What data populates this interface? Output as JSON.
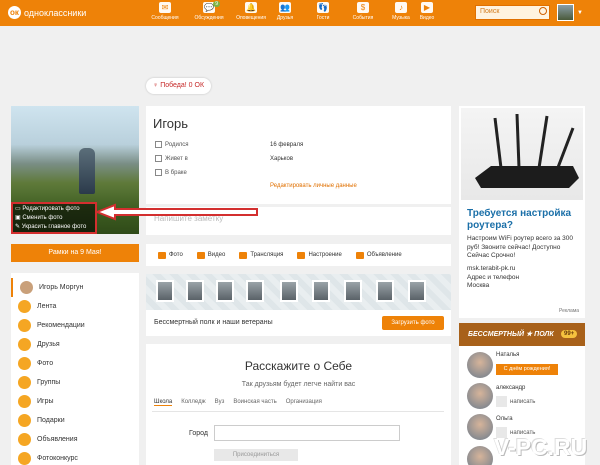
{
  "header": {
    "logo_text": "одноклассники",
    "logo_letter": "ок",
    "nav": [
      {
        "label": "Сообщения",
        "icon": "✉"
      },
      {
        "label": "Обсуждения",
        "icon": "💬",
        "badge": "9"
      },
      {
        "label": "Оповещения",
        "icon": "🔔"
      },
      {
        "label": "Друзья",
        "icon": "👥"
      },
      {
        "label": "Гости",
        "icon": "👣"
      },
      {
        "label": "События",
        "icon": "$"
      },
      {
        "label": "Музыка",
        "icon": "♪"
      },
      {
        "label": "Видео",
        "icon": "▶"
      }
    ],
    "search_placeholder": "Поиск",
    "caret": "▼"
  },
  "victory_label": "Победа! 0 ОК",
  "victory_icon": "♀",
  "photo_menu": [
    "Редактировать фото",
    "Сменить фото",
    "Украсить главное фото"
  ],
  "frames_button": "Рамки на 9 Мая!",
  "profile": {
    "name": "Игорь",
    "rows": [
      {
        "label": "Родился",
        "value": "16 февраля"
      },
      {
        "label": "Живет в",
        "value": "Харьков"
      },
      {
        "label": "В браке",
        "value": ""
      }
    ],
    "edit_link": "Редактировать личные данные"
  },
  "note_placeholder": "Напишите заметку",
  "post_actions": [
    "Фото",
    "Видео",
    "Трансляция",
    "Настроение",
    "Объявление"
  ],
  "left_nav": [
    "Игорь Моргун",
    "Лента",
    "Рекомендации",
    "Друзья",
    "Фото",
    "Группы",
    "Игры",
    "Подарки",
    "Объявления",
    "Фотоконкурс"
  ],
  "banner": {
    "text": "Бессмертный полк и наши ветераны",
    "button": "Загрузить фото"
  },
  "about": {
    "title": "Расскажите о Себе",
    "subtitle": "Так друзьям будет легче найти вас",
    "tabs": [
      "Школа",
      "Колледж",
      "Вуз",
      "Воинская часть",
      "Организация"
    ],
    "city_label": "Город",
    "join_button": "Присоединиться"
  },
  "ad": {
    "title": "Требуется настройка роутера?",
    "body": "Настроим WiFi роутер всего за 300 руб! Звоните сейчас! Доступно Сейчас Срочно!",
    "link_lines": [
      "msk.terabit-pk.ru",
      "Адрес и телефон",
      "Москва"
    ],
    "label": "Реклама"
  },
  "regiment": {
    "title": "БЕССМЕРТНЫЙ ★ ПОЛК",
    "count": "99+",
    "friends": [
      {
        "name": "Наталья",
        "action": "С днём рождения!"
      },
      {
        "name": "александр",
        "action": "написать"
      },
      {
        "name": "Ольга",
        "action": "написать"
      }
    ]
  },
  "watermark": "V-PC.RU",
  "colors": {
    "brand": "#ee8208",
    "ad_title": "#1a6fa8",
    "alert_red": "#d32f2f"
  }
}
